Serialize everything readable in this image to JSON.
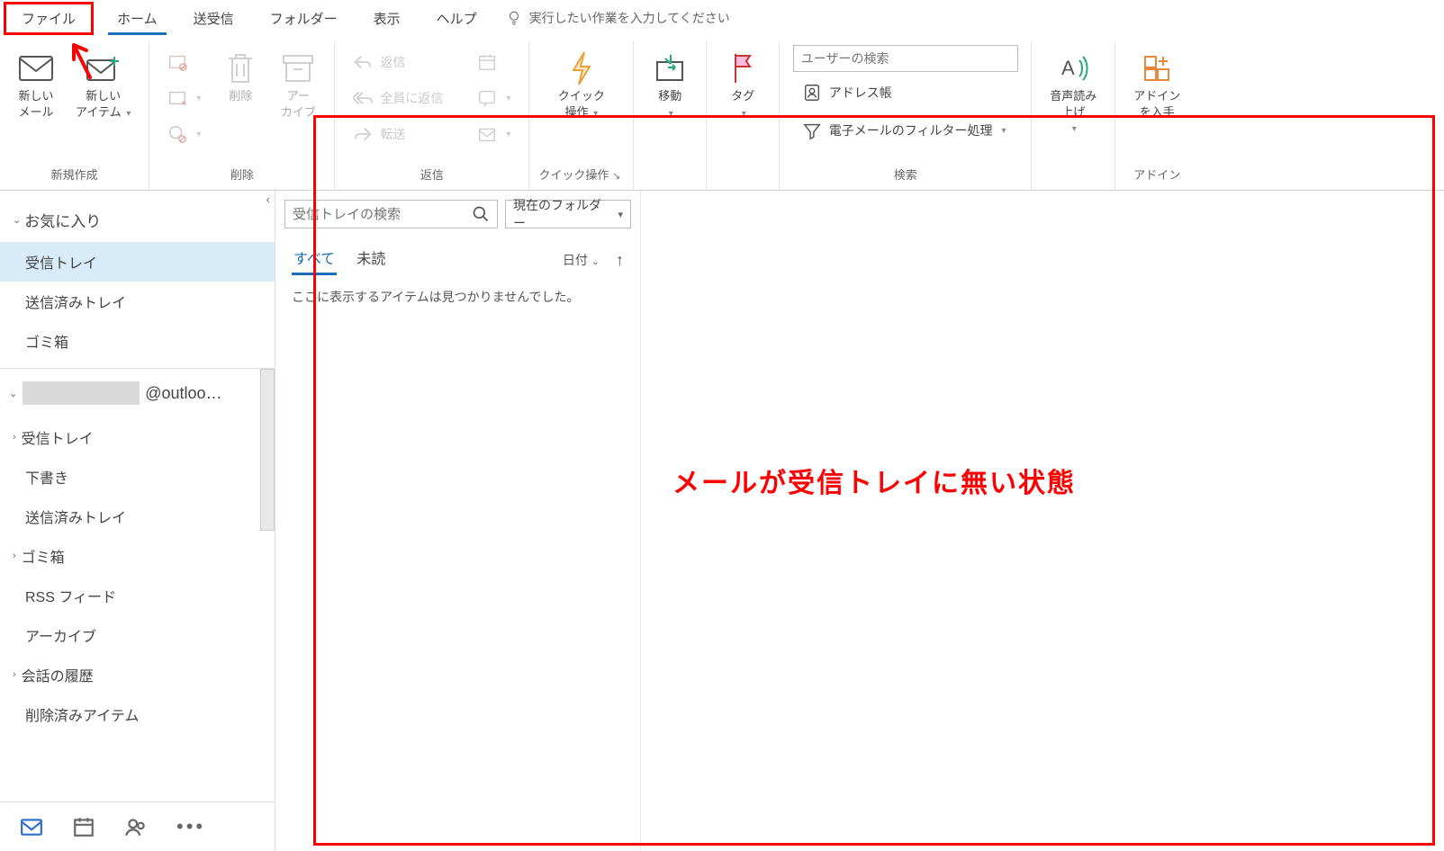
{
  "menu": {
    "file": "ファイル",
    "home": "ホーム",
    "sendrecv": "送受信",
    "folder": "フォルダー",
    "view": "表示",
    "help": "ヘルプ",
    "tellme": "実行したい作業を入力してください"
  },
  "ribbon": {
    "new_mail": "新しい\nメール",
    "new_item": "新しい\nアイテム",
    "group_new": "新規作成",
    "delete": "削除",
    "archive": "アー\nカイブ",
    "group_delete": "削除",
    "reply": "返信",
    "reply_all": "全員に返信",
    "forward": "転送",
    "group_reply": "返信",
    "quick_action": "クイック\n操作",
    "group_quick": "クイック操作",
    "move": "移動",
    "tag": "タグ",
    "search_placeholder": "ユーザーの検索",
    "address_book": "アドレス帳",
    "filter": "電子メールのフィルター処理",
    "group_search": "検索",
    "tts": "音声読み\n上げ",
    "addin": "アドイン\nを入手",
    "group_addin": "アドイン"
  },
  "sidebar": {
    "favorites": "お気に入り",
    "fav_items": [
      "受信トレイ",
      "送信済みトレイ",
      "ゴミ箱"
    ],
    "account_suffix": "@outloo…",
    "folders": [
      {
        "label": "受信トレイ",
        "chev": true
      },
      {
        "label": "下書き",
        "chev": false
      },
      {
        "label": "送信済みトレイ",
        "chev": false
      },
      {
        "label": "ゴミ箱",
        "chev": true
      },
      {
        "label": "RSS フィード",
        "chev": false
      },
      {
        "label": "アーカイブ",
        "chev": false
      },
      {
        "label": "会話の履歴",
        "chev": true
      },
      {
        "label": "削除済みアイテム",
        "chev": false
      }
    ]
  },
  "list": {
    "search_placeholder": "受信トレイの検索",
    "scope": "現在のフォルダー",
    "tab_all": "すべて",
    "tab_unread": "未読",
    "sort": "日付",
    "empty": "ここに表示するアイテムは見つかりませんでした。"
  },
  "annotation": "メールが受信トレイに無い状態"
}
